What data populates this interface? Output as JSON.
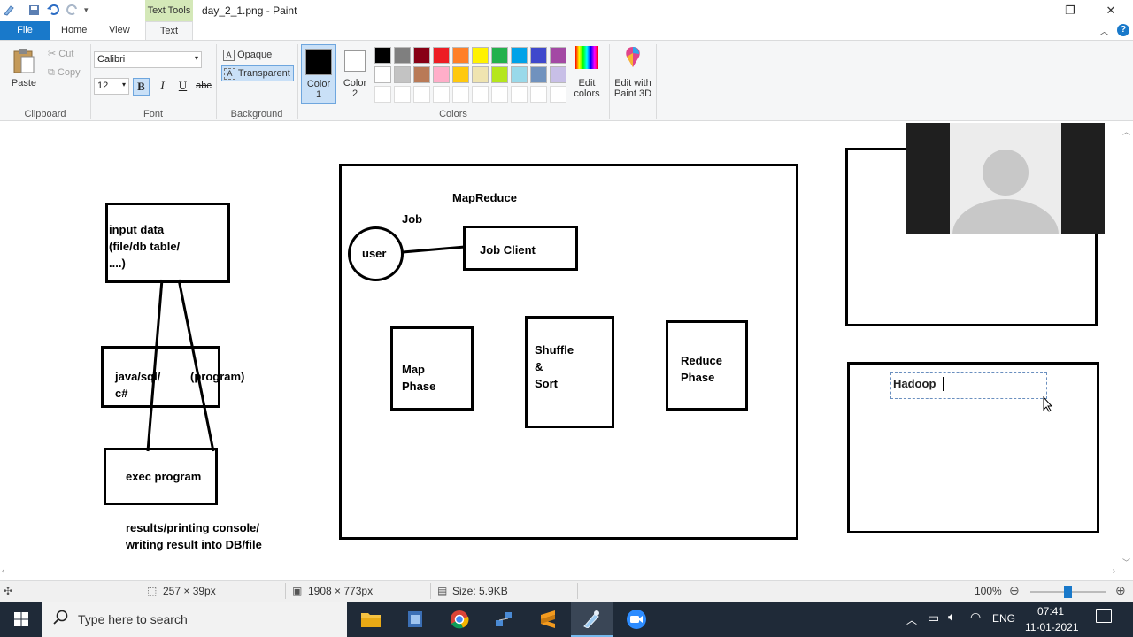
{
  "window": {
    "title": "day_2_1.png - Paint",
    "context_tab": "Text Tools"
  },
  "menu": {
    "file": "File",
    "home": "Home",
    "view": "View",
    "text": "Text"
  },
  "ribbon": {
    "clipboard": {
      "paste": "Paste",
      "cut": "Cut",
      "copy": "Copy",
      "group": "Clipboard"
    },
    "font": {
      "family": "Calibri",
      "size": "12",
      "bold": "B",
      "italic": "I",
      "underline": "U",
      "strike": "abc",
      "group": "Font"
    },
    "background": {
      "opaque": "Opaque",
      "transparent": "Transparent",
      "group": "Background"
    },
    "colors": {
      "color1": "Color\n1",
      "color1_l1": "Color",
      "color1_l2": "1",
      "color2_l1": "Color",
      "color2_l2": "2",
      "edit_l1": "Edit",
      "edit_l2": "colors",
      "p3d_l1": "Edit with",
      "p3d_l2": "Paint 3D",
      "group": "Colors",
      "palette_row1": [
        "#000000",
        "#7f7f7f",
        "#880015",
        "#ed1c24",
        "#ff7f27",
        "#fff200",
        "#22b14c",
        "#00a2e8",
        "#3f48cc",
        "#a349a4"
      ],
      "palette_row2": [
        "#ffffff",
        "#c3c3c3",
        "#b97a57",
        "#ffaec9",
        "#ffc90e",
        "#efe4b0",
        "#b5e61d",
        "#99d9ea",
        "#7092be",
        "#c8bfe7"
      ]
    }
  },
  "drawing": {
    "input_data_l1": "input data",
    "input_data_l2": "(file/db table/",
    "input_data_l3": "....)",
    "java_l1": "java/sql/",
    "java_l2": "c#",
    "program": "(program)",
    "exec": "exec program",
    "results_l1": "results/printing console/",
    "results_l2": "writing result into DB/file",
    "mapreduce": "MapReduce",
    "job": "Job",
    "user": "user",
    "job_client": "Job Client",
    "map_l1": "Map",
    "map_l2": "Phase",
    "shuffle_l1": "Shuffle",
    "shuffle_l2": "&",
    "shuffle_l3": "Sort",
    "reduce_l1": "Reduce",
    "reduce_l2": "Phase",
    "hadoop": "Hadoop"
  },
  "status": {
    "selection": "257 × 39px",
    "canvas_size": "1908 × 773px",
    "file_size": "Size: 5.9KB",
    "zoom": "100%"
  },
  "taskbar": {
    "search_placeholder": "Type here to search",
    "lang": "ENG",
    "time": "07:41",
    "date": "11-01-2021"
  }
}
